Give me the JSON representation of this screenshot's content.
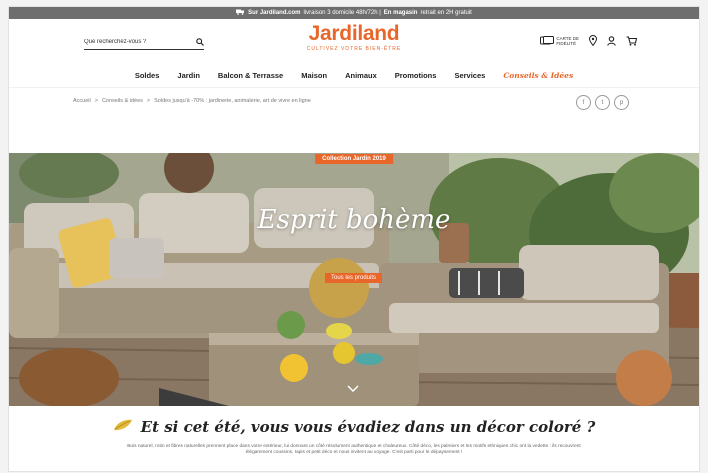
{
  "topbar": {
    "prefix": "Sur Jardiland.com",
    "middle": "livraison 3 domicile 48h/72h |",
    "store": "En magasin",
    "suffix": "retrait en 2H gratuit"
  },
  "search": {
    "placeholder": "Que recherchez-vous ?"
  },
  "logo": {
    "name": "Jardiland",
    "tagline": "CULTIVEZ VOTRE BIEN-ÊTRE"
  },
  "header": {
    "loyalty_line1": "CARTE DE",
    "loyalty_line2": "FIDÉLITÉ"
  },
  "nav": {
    "items": [
      "Soldes",
      "Jardin",
      "Balcon & Terrasse",
      "Maison",
      "Animaux",
      "Promotions",
      "Services",
      "Conseils & Idées"
    ]
  },
  "breadcrumb": {
    "items": [
      "Accueil",
      "Conseils & idées",
      "Soldes jusqu'à -70% : jardinerie, animalerie, art de vivre en ligne"
    ],
    "separator": ">"
  },
  "social": {
    "facebook": "f",
    "twitter": "t",
    "pinterest": "p"
  },
  "hero": {
    "badge": "Collection Jardin 2019",
    "headline": "Esprit bohème",
    "cta": "Tous les produits"
  },
  "intro": {
    "slogan": "Et si cet été, vous vous évadiez dans un décor coloré ?",
    "text": "Bois naturel, rotin et fibres naturelles prennent place dans votre extérieur, lui donnant un côté résolument authentique et chaleureux. Côté déco, les palmiers et les motifs ethniques chic ont la vedette : ils recouvrent élégamment coussins, tapis et petit déco et nous invitent au voyage. C'est parti pour le dépaysement !"
  },
  "colors": {
    "brand": "#e8662a",
    "topbar": "#6e6e6e"
  }
}
